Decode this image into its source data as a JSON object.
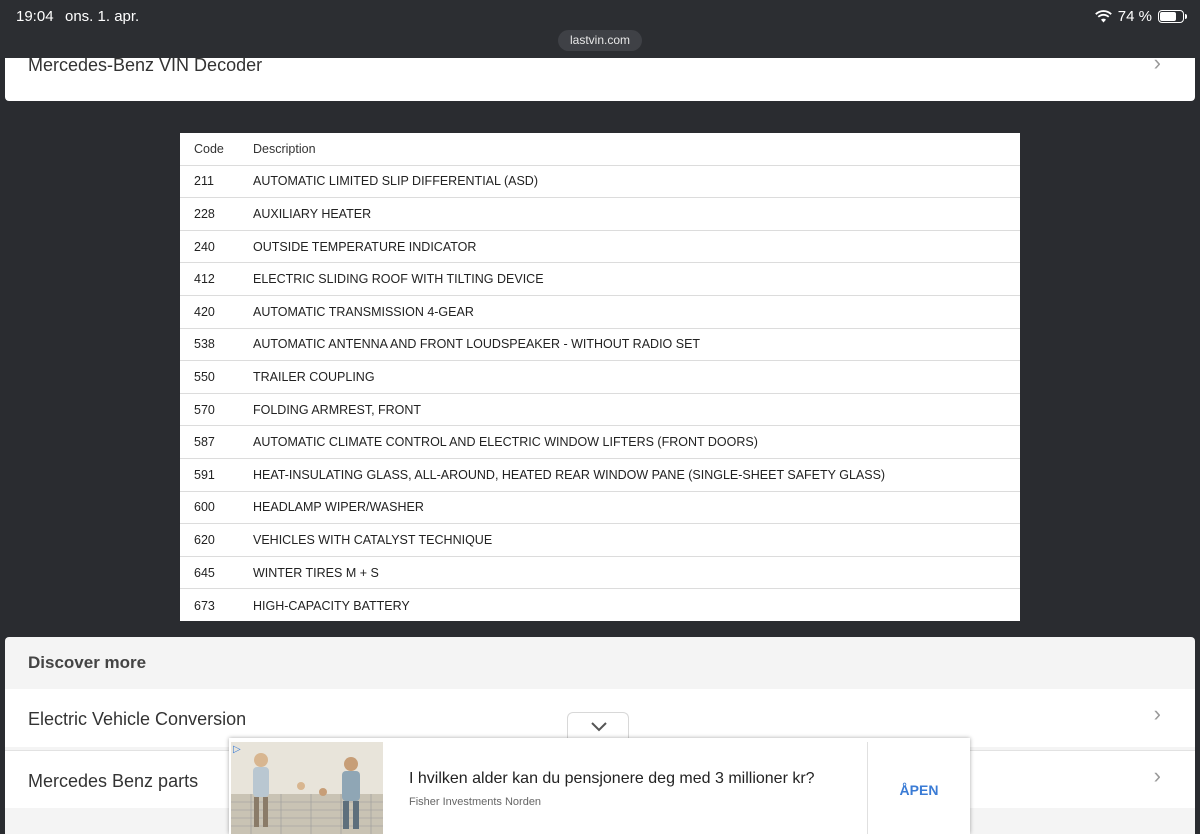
{
  "status_bar": {
    "time": "19:04",
    "date": "ons. 1. apr.",
    "battery": "74 %",
    "battery_level": 0.74,
    "url": "lastvin.com"
  },
  "top_card": {
    "title": "Mercedes-Benz VIN Decoder"
  },
  "codes_table": {
    "headers": {
      "code": "Code",
      "description": "Description"
    },
    "rows": [
      {
        "code": "211",
        "description": "AUTOMATIC LIMITED SLIP DIFFERENTIAL (ASD)"
      },
      {
        "code": "228",
        "description": "AUXILIARY HEATER"
      },
      {
        "code": "240",
        "description": "OUTSIDE TEMPERATURE INDICATOR"
      },
      {
        "code": "412",
        "description": "ELECTRIC SLIDING ROOF WITH TILTING DEVICE"
      },
      {
        "code": "420",
        "description": "AUTOMATIC TRANSMISSION 4-GEAR"
      },
      {
        "code": "538",
        "description": "AUTOMATIC ANTENNA AND FRONT LOUDSPEAKER - WITHOUT RADIO SET"
      },
      {
        "code": "550",
        "description": "TRAILER COUPLING"
      },
      {
        "code": "570",
        "description": "FOLDING ARMREST, FRONT"
      },
      {
        "code": "587",
        "description": "AUTOMATIC CLIMATE CONTROL AND ELECTRIC WINDOW LIFTERS (FRONT DOORS)"
      },
      {
        "code": "591",
        "description": "HEAT-INSULATING GLASS, ALL-AROUND, HEATED REAR WINDOW PANE (SINGLE-SHEET SAFETY GLASS)"
      },
      {
        "code": "600",
        "description": "HEADLAMP WIPER/WASHER"
      },
      {
        "code": "620",
        "description": "VEHICLES WITH CATALYST TECHNIQUE"
      },
      {
        "code": "645",
        "description": "WINTER TIRES M + S"
      },
      {
        "code": "673",
        "description": "HIGH-CAPACITY BATTERY"
      }
    ]
  },
  "discover": {
    "heading": "Discover more",
    "items": [
      {
        "label": "Electric Vehicle Conversion"
      },
      {
        "label": "Mercedes Benz parts"
      }
    ]
  },
  "ad": {
    "title": "I hvilken alder kan du pensjonere deg med 3 millioner kr?",
    "advertiser": "Fisher Investments Norden",
    "cta": "ÅPEN",
    "adchoices_icon": "adchoices-icon"
  }
}
